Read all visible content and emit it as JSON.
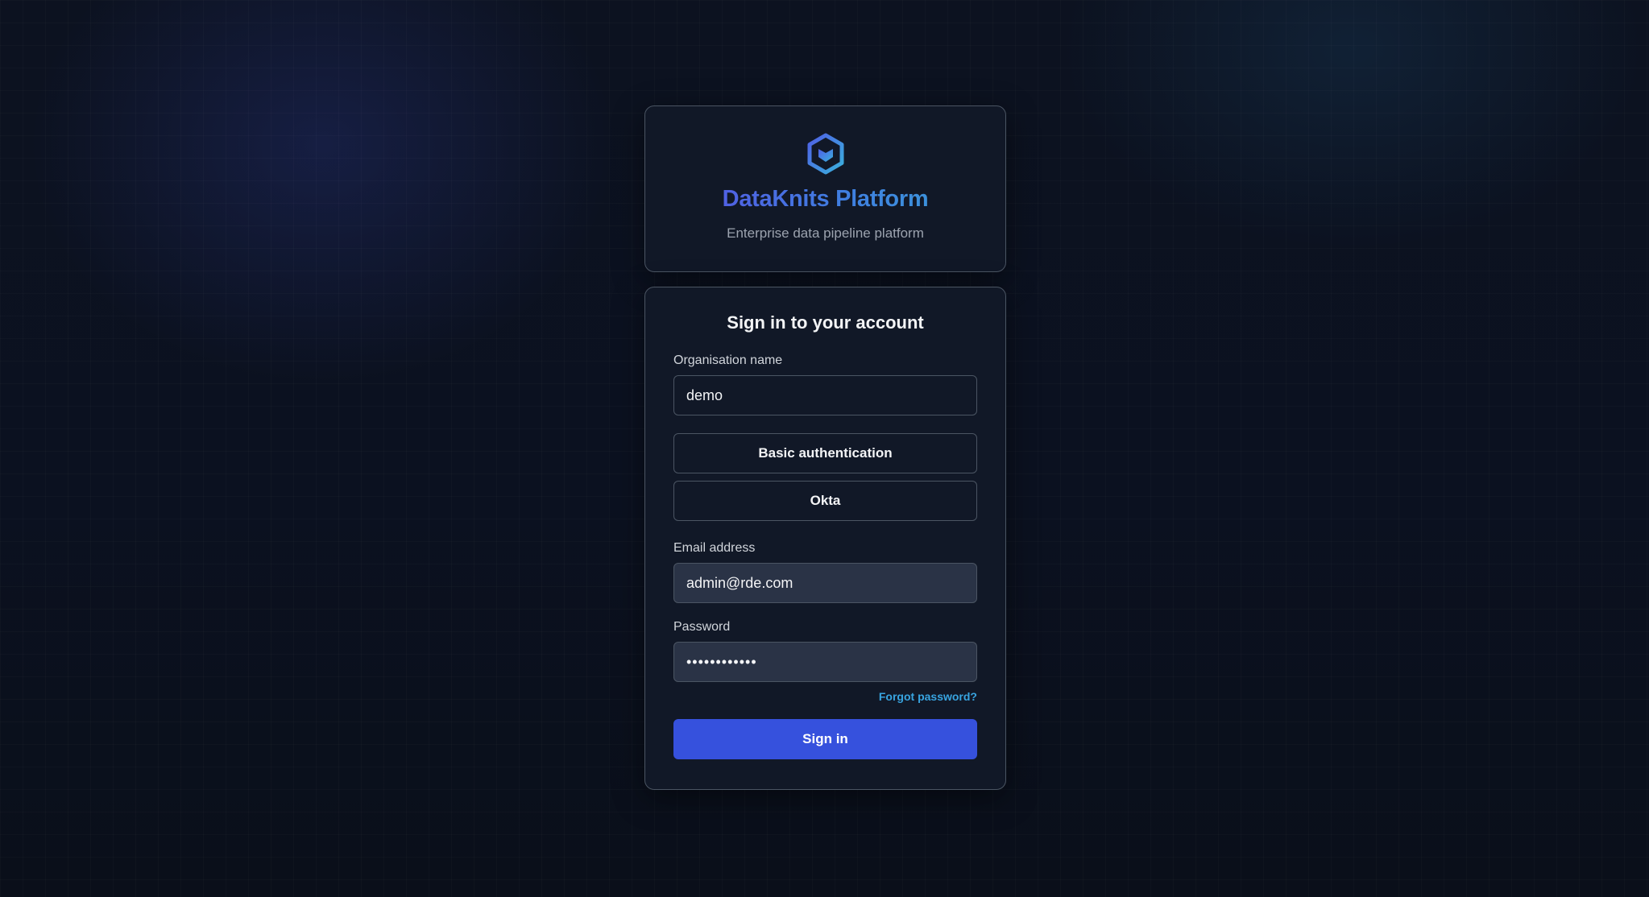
{
  "brand": {
    "title": "DataKnits Platform",
    "subtitle": "Enterprise data pipeline platform",
    "logo_icon": "hexagon-logo-icon",
    "gradient_colors": [
      "#5b4fe6",
      "#3f7ee0",
      "#3aa3d8"
    ]
  },
  "login": {
    "title": "Sign in to your account",
    "organisation": {
      "label": "Organisation name",
      "value": "demo"
    },
    "auth_methods": [
      {
        "label": "Basic authentication"
      },
      {
        "label": "Okta"
      }
    ],
    "email": {
      "label": "Email address",
      "value": "admin@rde.com"
    },
    "password": {
      "label": "Password",
      "value": "••••••••••••"
    },
    "forgot_label": "Forgot password?",
    "submit_label": "Sign in",
    "accent_color": "#3651dd",
    "link_color": "#38a4e0"
  }
}
